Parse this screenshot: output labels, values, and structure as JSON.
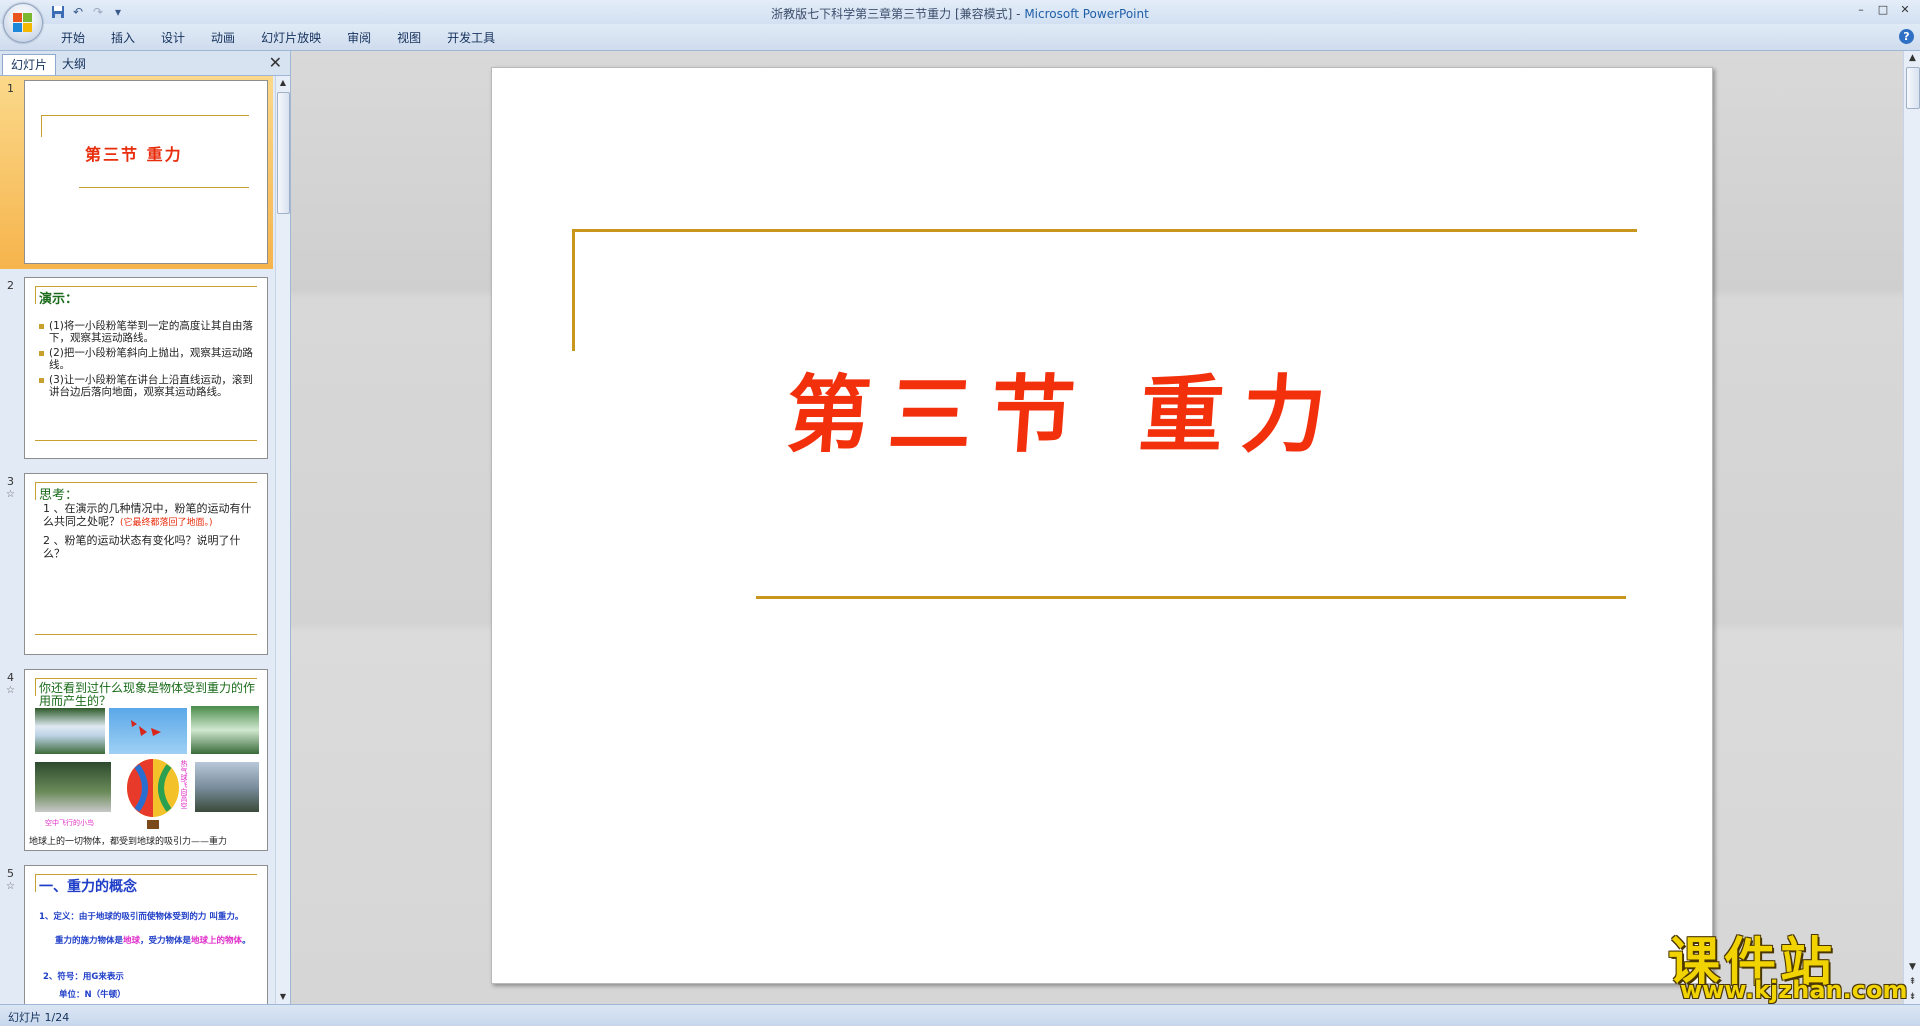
{
  "window": {
    "title": "浙教版七下科学第三章第三节重力 [兼容模式] - ",
    "app_name": "Microsoft PowerPoint",
    "controls": [
      "–",
      "□",
      "✕"
    ]
  },
  "qat": {
    "icons": [
      "save-icon",
      "undo-icon",
      "redo-icon",
      "customize-icon"
    ],
    "customize": "▾"
  },
  "ribbon": {
    "tabs": [
      "开始",
      "插入",
      "设计",
      "动画",
      "幻灯片放映",
      "审阅",
      "视图",
      "开发工具"
    ],
    "help": "?"
  },
  "left_pane": {
    "tabs": [
      "幻灯片",
      "大纲"
    ],
    "close": "✕",
    "slides": [
      {
        "num": "1",
        "title": "第三节  重力"
      },
      {
        "num": "2",
        "star": "☆",
        "heading": "演示：",
        "items": [
          "(1)将一小段粉笔举到一定的高度让其自由落下，观察其运动路线。",
          "(2)把一小段粉笔斜向上抛出，观察其运动路线。",
          "(3)让一小段粉笔在讲台上沿直线运动，滚到讲台边后落向地面，观察其运动路线。"
        ]
      },
      {
        "num": "3",
        "star": "☆",
        "heading": "思考：",
        "q1": "1 、在演示的几种情况中，粉笔的运动有什么共同之处呢？",
        "q1_answer": "(它最终都落回了地面。)",
        "q2": "2 、粉笔的运动状态有变化吗？说明了什么？"
      },
      {
        "num": "4",
        "star": "☆",
        "heading": "你还看到过什么现象是物体受到重力的作用而产生的？",
        "caption_bird": "空中飞行的小鸟",
        "caption_side": "热气球飞向高空",
        "footer": "地球上的一切物体，都受到地球的吸引力——重力"
      },
      {
        "num": "5",
        "star": "☆",
        "heading": "一、重力的概念",
        "line1": "1、定义：由于地球的吸引而使物体受到的力 叫重力。",
        "line2_a": "重力的施力物体是",
        "line2_b": "地球",
        "line2_c": "，受力物体是",
        "line2_d": "地球上的物体",
        "line2_e": "。",
        "line3": "2、符号：用G来表示",
        "line4": "单位：N（牛顿）"
      }
    ]
  },
  "slide": {
    "title": "第三节  重力"
  },
  "status": {
    "text": "幻灯片 1/24"
  },
  "watermark": {
    "big": "课件站",
    "small": "www.kjzhan.com"
  }
}
